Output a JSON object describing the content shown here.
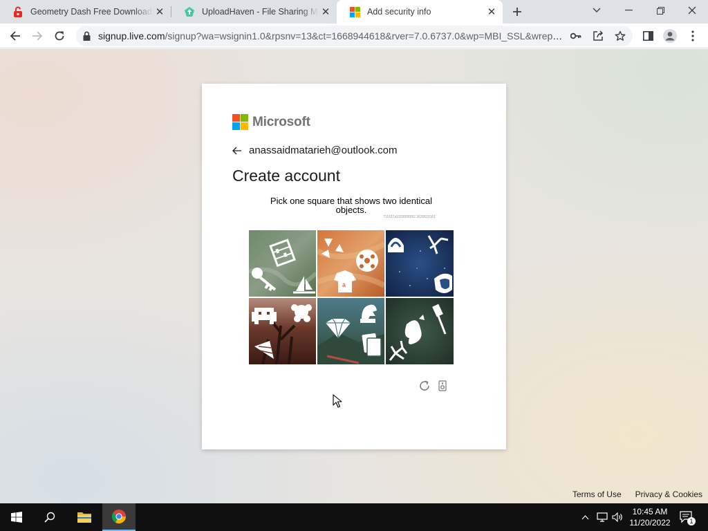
{
  "browser": {
    "tabs": [
      {
        "title": "Geometry Dash Free Download (",
        "favicon": "red-lock-favicon",
        "active": false
      },
      {
        "title": "UploadHaven - File Sharing Mad",
        "favicon": "green-uploadhaven-favicon",
        "active": false
      },
      {
        "title": "Add security info",
        "favicon": "microsoft-favicon",
        "active": true
      }
    ],
    "address": {
      "host": "signup.live.com",
      "path": "/signup?wa=wsignin1.0&rpsnv=13&ct=1668944618&rver=7.0.6737.0&wp=MBI_SSL&wrepl..."
    }
  },
  "card": {
    "brand": "Microsoft",
    "email": "anassaidmatarieh@outlook.com",
    "heading": "Create account",
    "prompt": "Pick one square that shows two identical objects.",
    "captcha_id": "711637a1929995552.3630615101",
    "tiles": [
      {
        "label": ""
      },
      {
        "label": ""
      },
      {
        "label": ""
      },
      {
        "label": ""
      },
      {
        "label": ""
      },
      {
        "label": ""
      }
    ]
  },
  "footer": {
    "terms": "Terms of Use",
    "privacy": "Privacy & Cookies"
  },
  "taskbar": {
    "time": "10:45 AM",
    "date": "11/20/2022",
    "notifications": "1"
  },
  "colors": {
    "ms_red": "#f25022",
    "ms_green": "#7fba00",
    "ms_blue": "#00a4ef",
    "ms_yellow": "#ffb900",
    "taskbar": "#101010"
  }
}
